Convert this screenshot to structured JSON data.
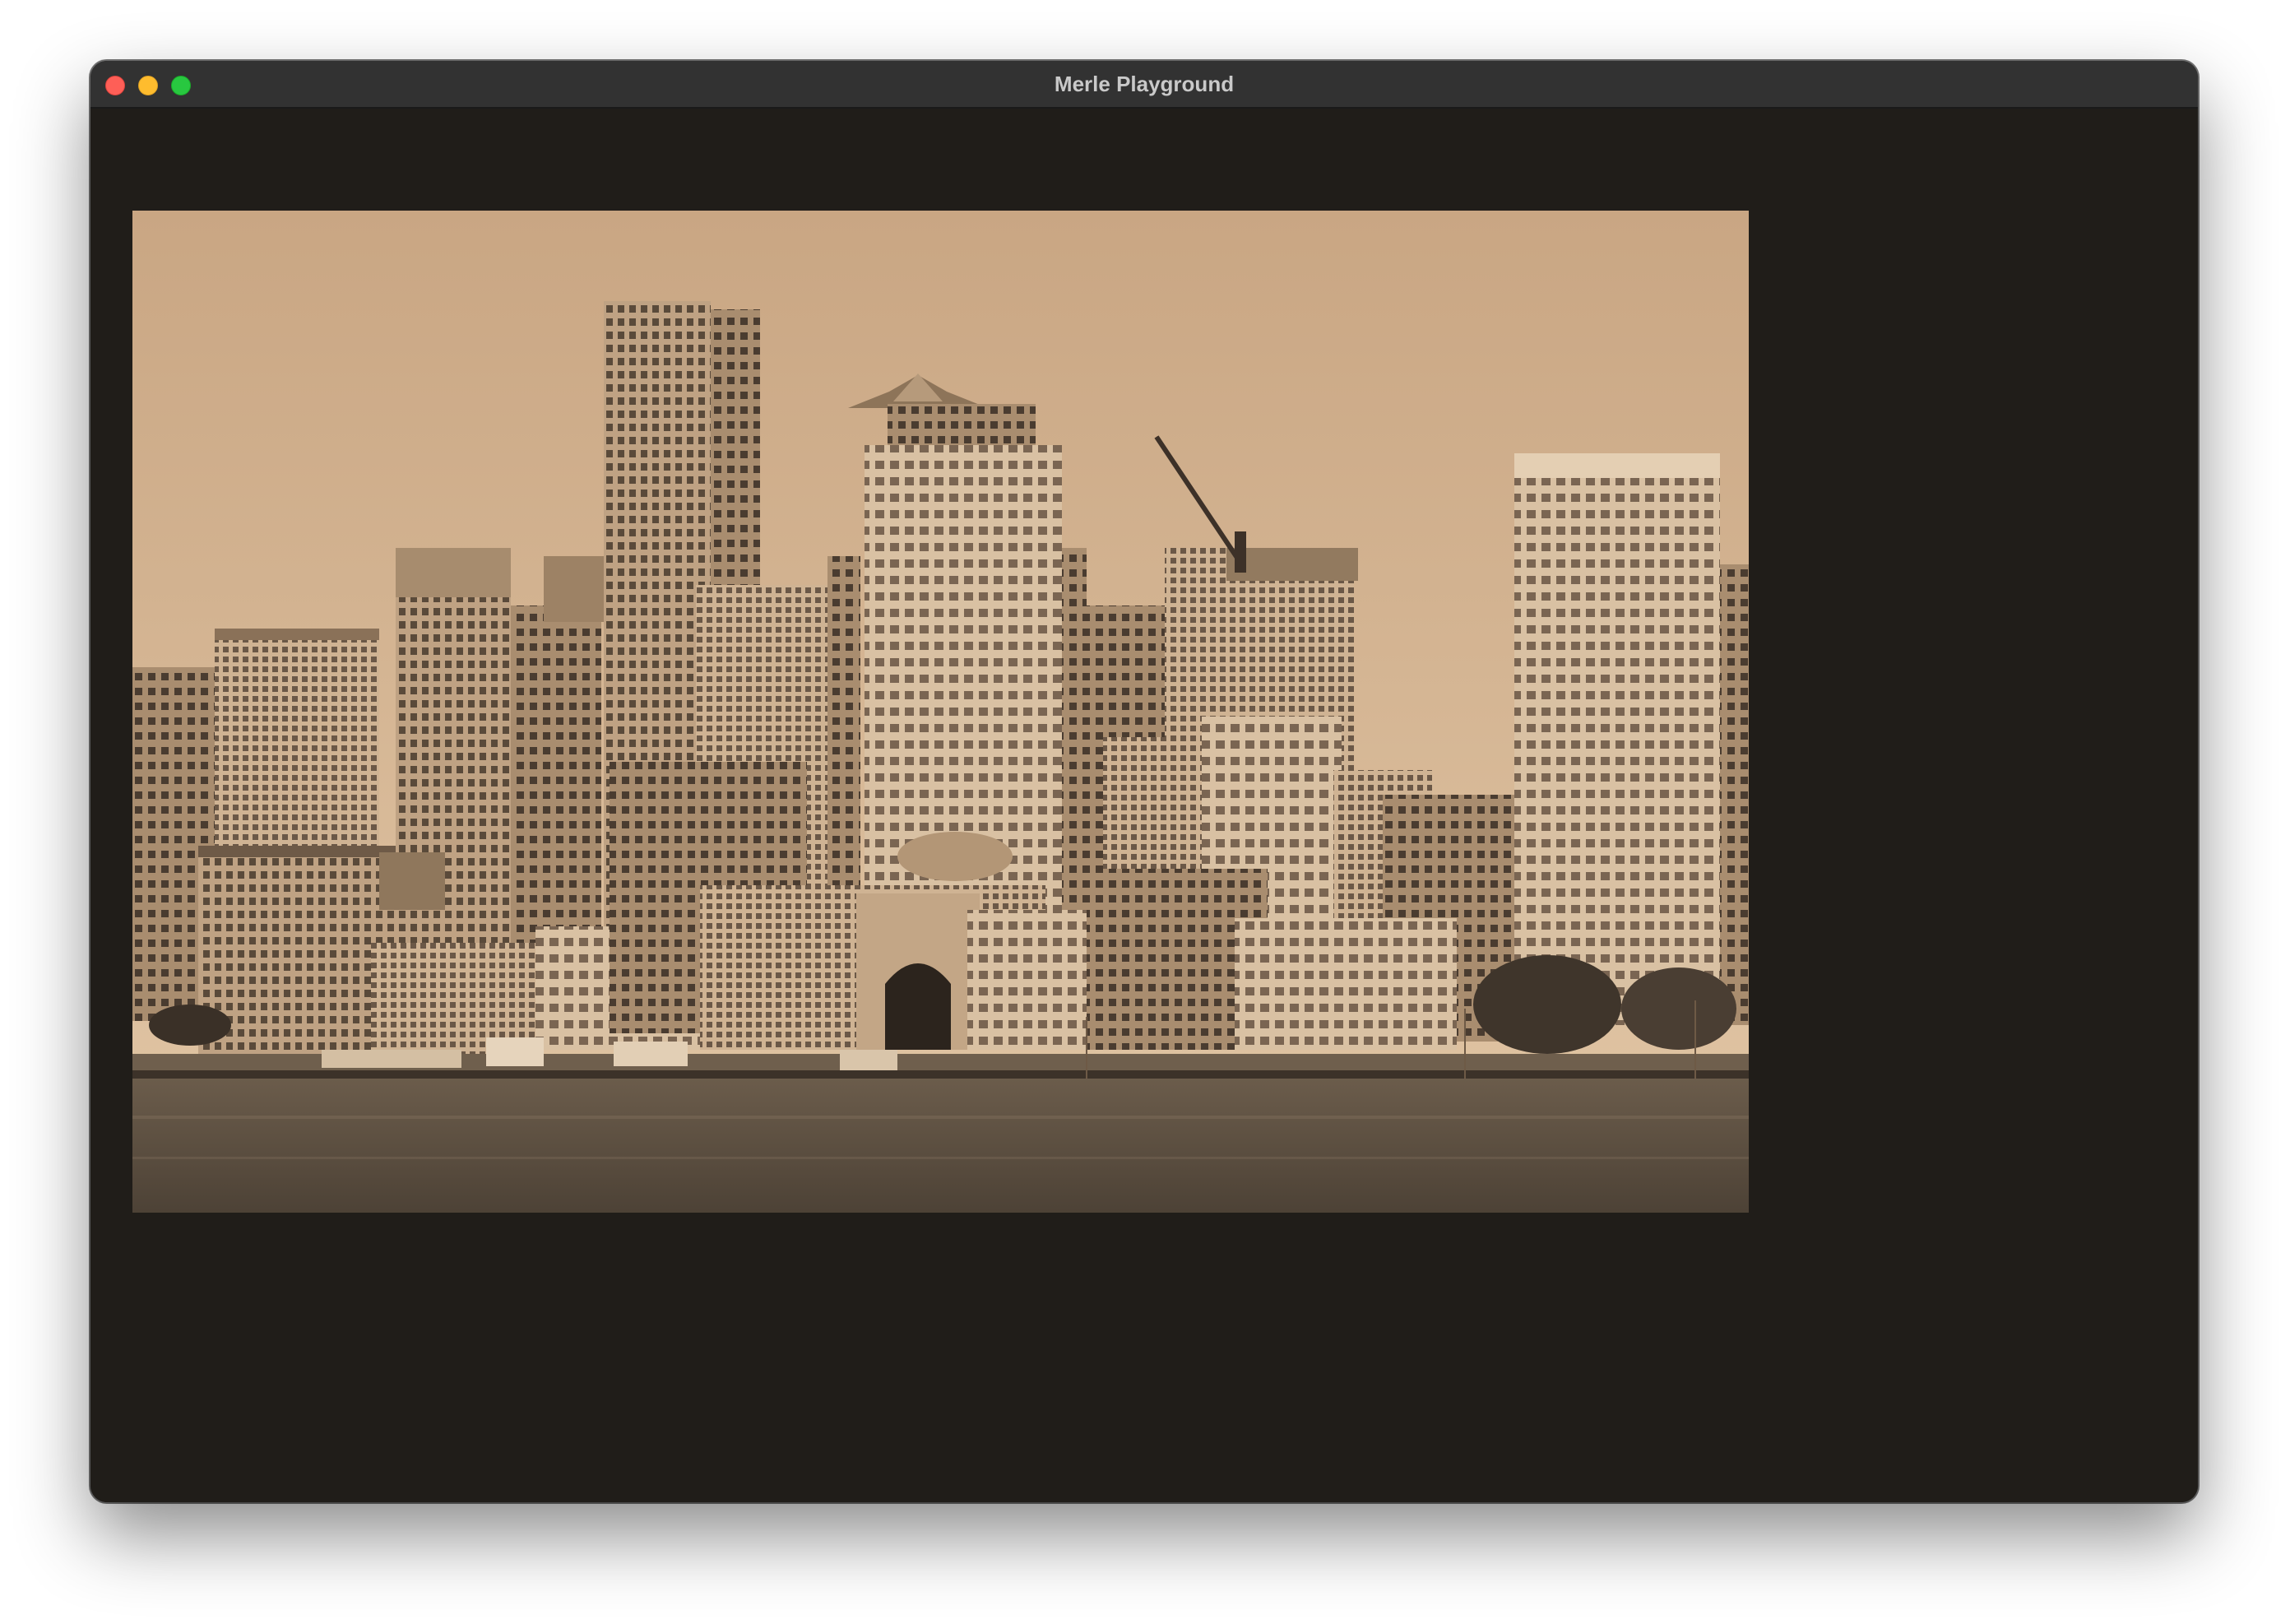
{
  "window": {
    "title": "Merle Playground"
  },
  "controls": {
    "close": "close-icon",
    "minimize": "minimize-icon",
    "maximize": "maximize-icon"
  },
  "image": {
    "description_kind": "sepia-toned photo",
    "tone": "#d2b08c"
  }
}
